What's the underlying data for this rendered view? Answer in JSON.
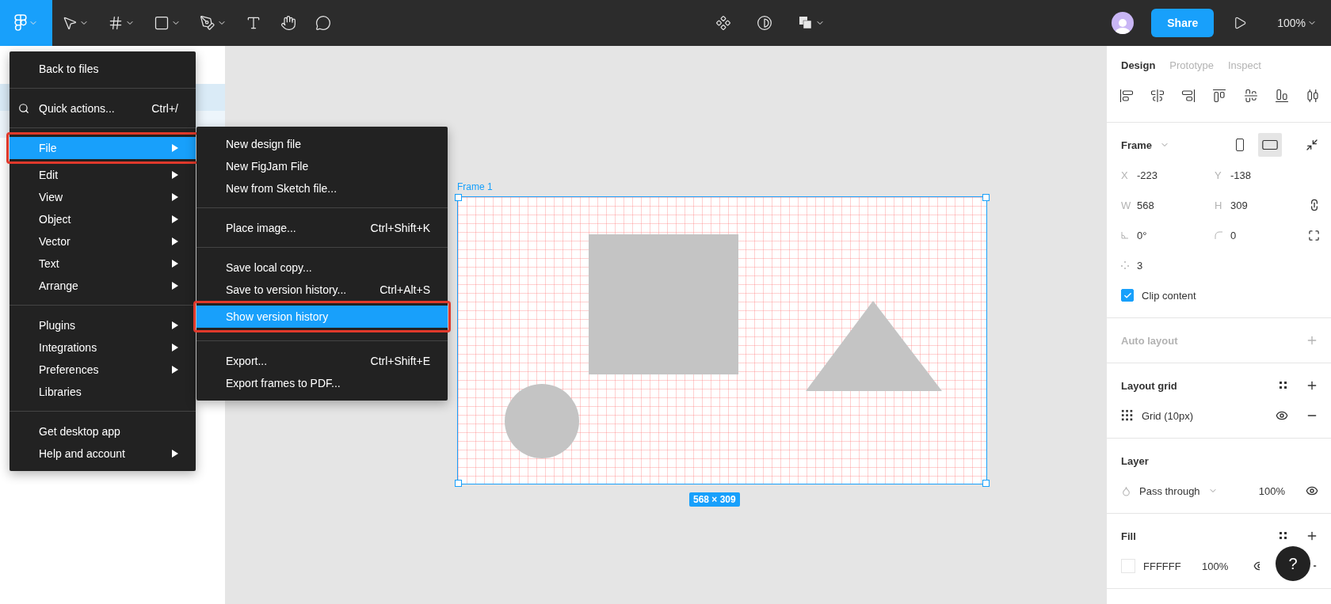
{
  "toolbar": {
    "tools": [
      {
        "kind": "main-menu",
        "selected": true
      },
      {
        "kind": "move",
        "selected": false
      },
      {
        "kind": "frame",
        "selected": false
      },
      {
        "kind": "shape",
        "selected": false
      },
      {
        "kind": "pen",
        "selected": false
      },
      {
        "kind": "text",
        "selected": false
      },
      {
        "kind": "hand",
        "selected": false
      },
      {
        "kind": "comment",
        "selected": false
      }
    ],
    "center_tools": [
      {
        "kind": "component"
      },
      {
        "kind": "mask"
      },
      {
        "kind": "boolean"
      }
    ],
    "share": "Share",
    "zoom": "100%"
  },
  "menu": {
    "items": [
      {
        "kind": "item",
        "label": "Back to files",
        "submenu": false,
        "selected": false,
        "outlined": false
      },
      {
        "kind": "separator"
      },
      {
        "kind": "search",
        "label": "Quick actions...",
        "shortcut": "Ctrl+/",
        "submenu": false,
        "selected": false,
        "outlined": false
      },
      {
        "kind": "separator"
      },
      {
        "kind": "item",
        "label": "File",
        "submenu": true,
        "selected": true,
        "outlined": true
      },
      {
        "kind": "item",
        "label": "Edit",
        "submenu": true,
        "selected": false,
        "outlined": false
      },
      {
        "kind": "item",
        "label": "View",
        "submenu": true,
        "selected": false,
        "outlined": false
      },
      {
        "kind": "item",
        "label": "Object",
        "submenu": true,
        "selected": false,
        "outlined": false
      },
      {
        "kind": "item",
        "label": "Vector",
        "submenu": true,
        "selected": false,
        "outlined": false
      },
      {
        "kind": "item",
        "label": "Text",
        "submenu": true,
        "selected": false,
        "outlined": false
      },
      {
        "kind": "item",
        "label": "Arrange",
        "submenu": true,
        "selected": false,
        "outlined": false
      },
      {
        "kind": "separator"
      },
      {
        "kind": "item",
        "label": "Plugins",
        "submenu": true,
        "selected": false,
        "outlined": false
      },
      {
        "kind": "item",
        "label": "Integrations",
        "submenu": true,
        "selected": false,
        "outlined": false
      },
      {
        "kind": "item",
        "label": "Preferences",
        "submenu": true,
        "selected": false,
        "outlined": false
      },
      {
        "kind": "item",
        "label": "Libraries",
        "submenu": false,
        "selected": false,
        "outlined": false
      },
      {
        "kind": "separator"
      },
      {
        "kind": "item",
        "label": "Get desktop app",
        "submenu": false,
        "selected": false,
        "outlined": false
      },
      {
        "kind": "item",
        "label": "Help and account",
        "submenu": true,
        "selected": false,
        "outlined": false
      }
    ]
  },
  "submenu": {
    "items": [
      {
        "kind": "item",
        "label": "New design file",
        "selected": false,
        "outlined": false
      },
      {
        "kind": "item",
        "label": "New FigJam File",
        "selected": false,
        "outlined": false
      },
      {
        "kind": "item",
        "label": "New from Sketch file...",
        "selected": false,
        "outlined": false
      },
      {
        "kind": "separator"
      },
      {
        "kind": "item",
        "label": "Place image...",
        "shortcut": "Ctrl+Shift+K",
        "selected": false,
        "outlined": false
      },
      {
        "kind": "separator"
      },
      {
        "kind": "item",
        "label": "Save local copy...",
        "selected": false,
        "outlined": false
      },
      {
        "kind": "item",
        "label": "Save to version history...",
        "shortcut": "Ctrl+Alt+S",
        "selected": false,
        "outlined": false
      },
      {
        "kind": "item",
        "label": "Show version history",
        "selected": true,
        "outlined": true
      },
      {
        "kind": "separator"
      },
      {
        "kind": "item",
        "label": "Export...",
        "shortcut": "Ctrl+Shift+E",
        "selected": false,
        "outlined": false
      },
      {
        "kind": "item",
        "label": "Export frames to PDF...",
        "selected": false,
        "outlined": false
      }
    ]
  },
  "canvas": {
    "frame": {
      "label": "Frame 1",
      "size": "568 × 309",
      "shapes": [
        {
          "kind": "rectangle"
        },
        {
          "kind": "triangle"
        },
        {
          "kind": "ellipse"
        }
      ]
    }
  },
  "inspector": {
    "tabs": [
      {
        "label": "Design",
        "selected": true
      },
      {
        "label": "Prototype",
        "selected": false
      },
      {
        "label": "Inspect",
        "selected": false
      }
    ],
    "frame": {
      "title": "Frame",
      "orientation": [
        {
          "kind": "portrait",
          "selected": false
        },
        {
          "kind": "landscape",
          "selected": true
        }
      ],
      "rows": [
        {
          "kind": "none",
          "fields": [
            {
              "kind": "letter",
              "label": "X",
              "value": "-223"
            },
            {
              "kind": "letter",
              "label": "Y",
              "value": "-138"
            }
          ]
        },
        {
          "kind": "constrain",
          "fields": [
            {
              "kind": "letter",
              "label": "W",
              "value": "568"
            },
            {
              "kind": "letter",
              "label": "H",
              "value": "309"
            }
          ]
        },
        {
          "kind": "corners",
          "fields": [
            {
              "kind": "angle",
              "value": "0°"
            },
            {
              "kind": "radius",
              "value": "0"
            }
          ]
        },
        {
          "kind": "none",
          "fields": [
            {
              "kind": "points",
              "value": "3"
            }
          ]
        }
      ],
      "clip": {
        "label": "Clip content",
        "checked": true
      }
    },
    "auto_layout": {
      "title": "Auto layout",
      "disabled": true
    },
    "layout_grid": {
      "title": "Layout grid",
      "items": [
        {
          "label": "Grid (10px)",
          "visible": true
        }
      ]
    },
    "layer": {
      "title": "Layer",
      "blend": "Pass through",
      "opacity": "100%",
      "visible": true
    },
    "fill": {
      "title": "Fill",
      "items": [
        {
          "color": "FFFFFF",
          "opacity": "100%"
        }
      ]
    }
  },
  "help": "?"
}
